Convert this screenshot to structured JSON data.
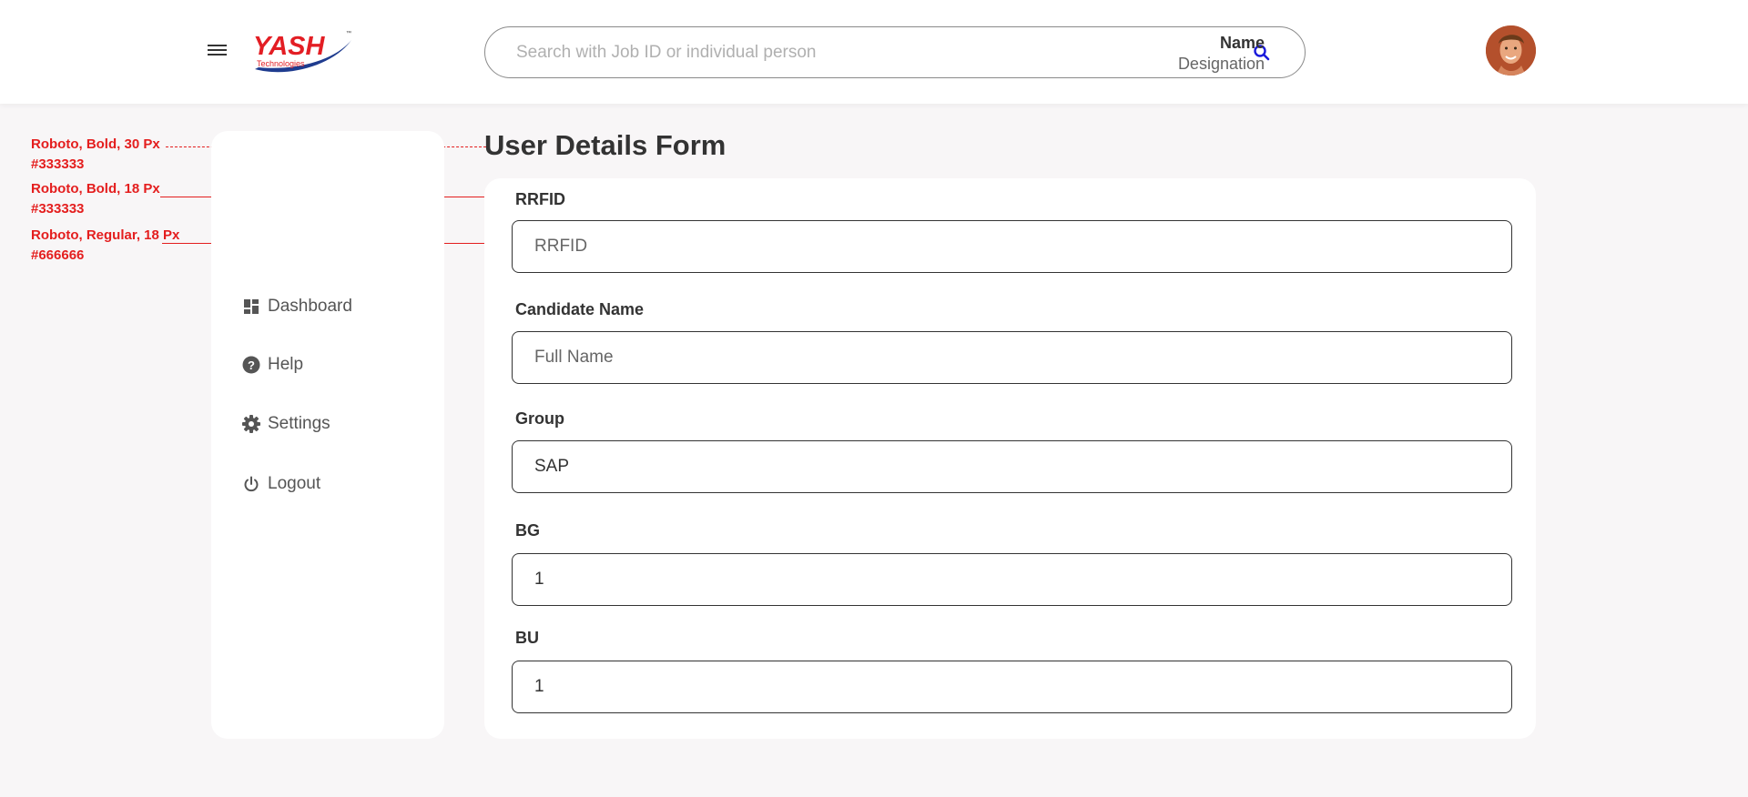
{
  "header": {
    "logo_text": "YASH",
    "logo_subtext": "Technologies",
    "logo_tm": "™",
    "search_placeholder": "Search with Job ID or individual person",
    "user_name": "Name",
    "user_designation": "Designation"
  },
  "annotations": [
    {
      "line1": "Roboto, Bold, 30 Px",
      "line2": "#333333"
    },
    {
      "line1": "Roboto, Bold, 18 Px",
      "line2": "#333333"
    },
    {
      "line1": "Roboto, Regular, 18 Px",
      "line2": "#666666"
    }
  ],
  "sidebar": {
    "items": [
      {
        "label": "Dashboard",
        "icon": "dashboard-icon"
      },
      {
        "label": "Help",
        "icon": "help-icon"
      },
      {
        "label": "Settings",
        "icon": "gear-icon"
      },
      {
        "label": "Logout",
        "icon": "power-icon"
      }
    ]
  },
  "form": {
    "title": "User Details Form",
    "fields": [
      {
        "label": "RRFID",
        "value": "",
        "placeholder": "RRFID"
      },
      {
        "label": "Candidate Name",
        "value": "",
        "placeholder": "Full Name"
      },
      {
        "label": "Group",
        "value": "SAP",
        "placeholder": ""
      },
      {
        "label": "BG",
        "value": "1",
        "placeholder": ""
      },
      {
        "label": "BU",
        "value": "1",
        "placeholder": ""
      }
    ]
  },
  "colors": {
    "annotation": "#e41e1e",
    "heading": "#333333",
    "body_text": "#666666",
    "search_icon": "#1a1adb",
    "logo_red": "#e31e24",
    "logo_blue": "#1f3c8f"
  }
}
